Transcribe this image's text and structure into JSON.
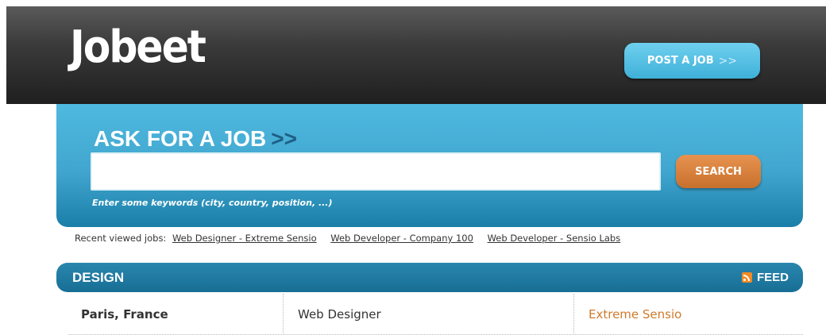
{
  "header": {
    "logo_text": "Jobeet",
    "post_job_label": "POST A JOB",
    "post_job_arrows": ">>"
  },
  "search": {
    "title": "ASK FOR A JOB",
    "title_arrows": ">>",
    "input_value": "",
    "button_label": "SEARCH",
    "help_text": "Enter some keywords (city, country, position, ...)"
  },
  "recent": {
    "label": "Recent viewed jobs:",
    "links": [
      "Web Designer - Extreme Sensio",
      "Web Developer - Company 100",
      "Web Developer - Sensio Labs"
    ]
  },
  "category": {
    "title": "DESIGN",
    "feed_label": "FEED",
    "jobs": [
      {
        "location": "Paris, France",
        "position": "Web Designer",
        "company": "Extreme Sensio"
      }
    ]
  },
  "colors": {
    "header_dark": "#2a2a2a",
    "accent_blue": "#45b0db",
    "category_blue": "#1f7ca3",
    "accent_orange": "#d07a2c"
  }
}
